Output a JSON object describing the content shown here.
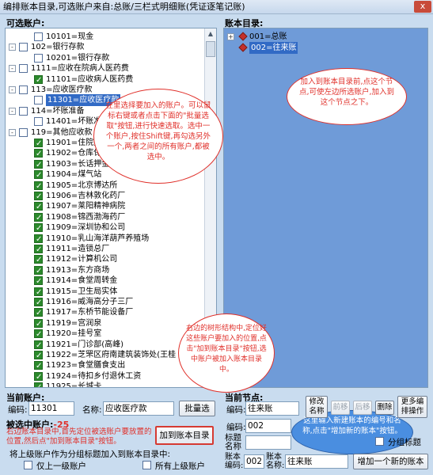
{
  "window": {
    "title": "编排账本目录,可选账户来自:总账/三栏式明细账(凭证逐笔记账)",
    "close_label": "x"
  },
  "left_panel": {
    "label": "可选账户:",
    "items": [
      {
        "text": "10101=现金",
        "checked": false,
        "depth": 1
      },
      {
        "text": "102=银行存款",
        "checked": false,
        "depth": 0,
        "expander": "-"
      },
      {
        "text": "10201=银行存款",
        "checked": false,
        "depth": 1
      },
      {
        "text": "1111=应收在院病人医药费",
        "checked": false,
        "depth": 0,
        "expander": "-"
      },
      {
        "text": "11101=应收病人医药费",
        "checked": true,
        "depth": 1
      },
      {
        "text": "113=应收医疗款",
        "checked": false,
        "depth": 0,
        "expander": "-"
      },
      {
        "text": "11301=应收医疗款",
        "checked": false,
        "depth": 1,
        "selected": true
      },
      {
        "text": "114=坏账准备",
        "checked": false,
        "depth": 0,
        "expander": "-"
      },
      {
        "text": "11401=坏账准备",
        "checked": false,
        "depth": 1
      },
      {
        "text": "119=其他应收款",
        "checked": false,
        "depth": 0,
        "expander": "-"
      },
      {
        "text": "11901=住院处",
        "checked": true,
        "depth": 1
      },
      {
        "text": "11902=仓库保管",
        "checked": true,
        "depth": 1
      },
      {
        "text": "11903=长话押金",
        "checked": true,
        "depth": 1
      },
      {
        "text": "11904=煤气站",
        "checked": true,
        "depth": 1
      },
      {
        "text": "11905=北京博达所",
        "checked": true,
        "depth": 1
      },
      {
        "text": "11906=吉林敦化药厂",
        "checked": true,
        "depth": 1
      },
      {
        "text": "11907=莱阳精神病院",
        "checked": true,
        "depth": 1
      },
      {
        "text": "11908=锦西渤海药厂",
        "checked": true,
        "depth": 1
      },
      {
        "text": "11909=深圳协和公司",
        "checked": true,
        "depth": 1
      },
      {
        "text": "11910=乳山海洋葫芦养殖场",
        "checked": true,
        "depth": 1
      },
      {
        "text": "11911=造锁总厂",
        "checked": true,
        "depth": 1
      },
      {
        "text": "11912=计算机公司",
        "checked": true,
        "depth": 1
      },
      {
        "text": "11913=东方商场",
        "checked": true,
        "depth": 1
      },
      {
        "text": "11914=食堂周转金",
        "checked": true,
        "depth": 1
      },
      {
        "text": "11915=卫生局实体",
        "checked": true,
        "depth": 1
      },
      {
        "text": "11916=威海高分子三厂",
        "checked": true,
        "depth": 1
      },
      {
        "text": "11917=东桥节能设备厂",
        "checked": true,
        "depth": 1
      },
      {
        "text": "11919=宫润泉",
        "checked": true,
        "depth": 1
      },
      {
        "text": "11920=挂号室",
        "checked": true,
        "depth": 1
      },
      {
        "text": "11921=门诊部(高峰)",
        "checked": true,
        "depth": 1
      },
      {
        "text": "11922=芝罘区府南建筑装饰处(王桂",
        "checked": true,
        "depth": 1
      },
      {
        "text": "11923=食堂膳食支出",
        "checked": true,
        "depth": 1
      },
      {
        "text": "11924=待扣乡付退休工资",
        "checked": true,
        "depth": 1
      },
      {
        "text": "11925=长城卡",
        "checked": true,
        "depth": 1
      }
    ]
  },
  "right_panel": {
    "label": "账本目录:",
    "items": [
      {
        "text": "001=总账",
        "expander": "+"
      },
      {
        "text": "002=往来账",
        "selected": true
      }
    ]
  },
  "bubbles": {
    "left_tip": "在里选择要加入的账户。可以鼠标右键或者点击下面的\"批量选取\"按钮,进行快速选取。选中一个账户,按住Shift键,再勾选另外一个,两者之间的所有账户,都被选中。",
    "right_tip": "加入到账本目录前,点这个节点,可使左边所选账户,加入到这个节点之下。",
    "tree_tip": "右边的树形结构中,定位好这些账户要加入的位置,点击\"加到账本目录\"按钮,选中账户被加入账本目录中。",
    "new_tip": "这里输入新建账本的编号和名称,点击\"增加新的账本\"按钮。"
  },
  "current_account": {
    "label": "当前账户:",
    "code_label": "编码:",
    "code_value": "11301",
    "name_label": "名称:",
    "name_value": "应收医疗款",
    "batch_button": "批量选"
  },
  "selected_accounts": {
    "label": "被选中账户:",
    "count": "-25",
    "hint": "右边账本目录中,首先定位被选账户要放置的位置,然后点\"加到账本目录\"按钮。",
    "add_button": "加到账本目录",
    "group_hint": "将上级账户作为分组标题加入到账本目录中:",
    "opt_one": "仅上一级账户",
    "opt_all": "所有上级账户"
  },
  "current_node": {
    "label": "当前节点:",
    "code_label": "编码:",
    "code_value": "002",
    "name_label": "名称:",
    "name_value": "往来账",
    "modify_button": "修改名称",
    "up_button": "前移",
    "down_button": "后移",
    "delete_button": "删除",
    "more_button": "更多编排操作",
    "title_label": "标题名称",
    "title_code_label": "编码:",
    "title_code_value": "002",
    "group_title": "分组标题",
    "book_code_label": "账本编码:",
    "book_code_value": "002",
    "book_name_label": "账本名称:",
    "book_name_value": "往来账",
    "add_book_button": "增加一个新的账本"
  }
}
